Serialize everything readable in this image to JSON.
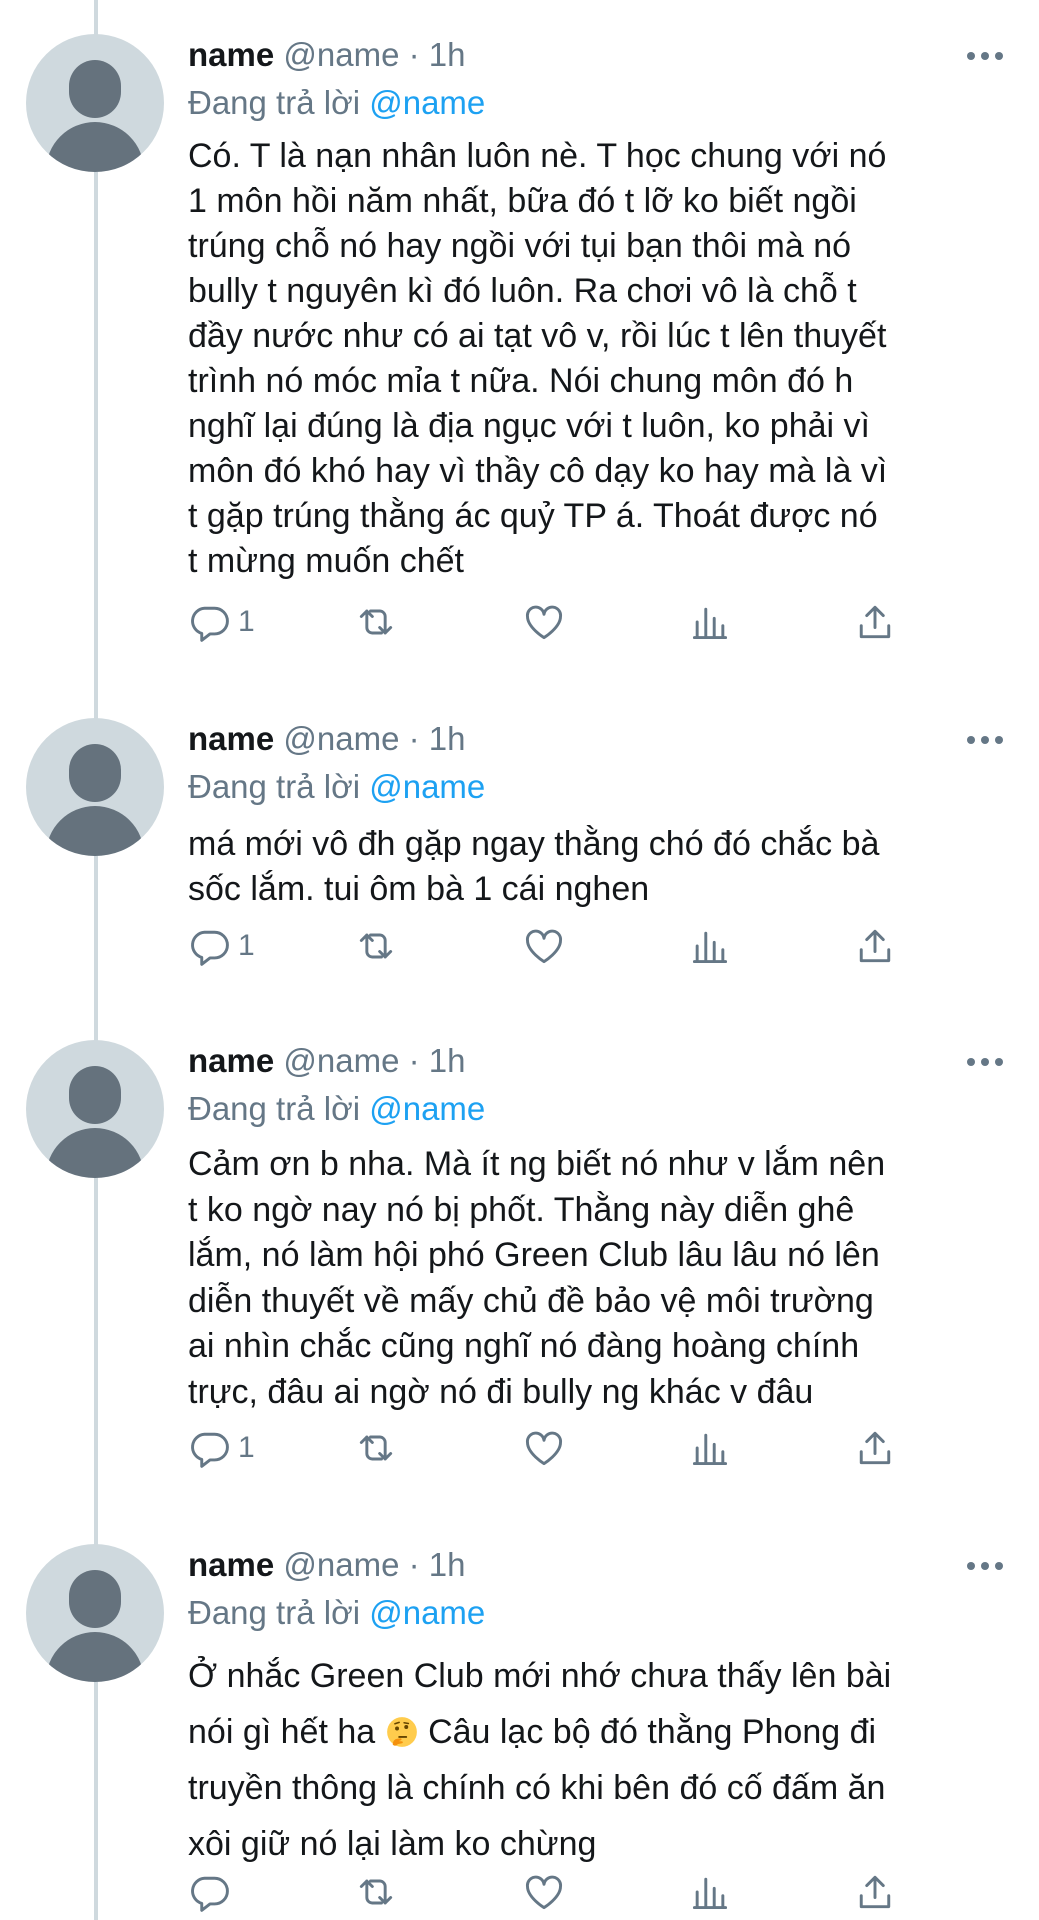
{
  "tweets": [
    {
      "display_name": "name",
      "handle": "@name",
      "separator": "·",
      "time": "1h",
      "replying_prefix": "Đang trả lời",
      "replying_to": "@name",
      "lines": [
        "Có. T là nạn nhân luôn nè. T học chung với nó",
        "1 môn hồi năm nhất, bữa đó t lỡ ko biết ngồi",
        "trúng chỗ nó hay ngồi với tụi bạn thôi mà nó",
        "bully t nguyên kì đó luôn. Ra chơi vô là chỗ t",
        "đầy nước như có ai tạt vô v, rồi lúc t lên thuyết",
        "trình nó móc mỉa t nữa. Nói chung môn đó h",
        "nghĩ lại đúng là địa ngục với t luôn, ko phải vì",
        "môn đó khó hay vì thầy cô dạy ko hay mà là vì",
        "t gặp trúng thằng ác quỷ TP á. Thoát được nó",
        "t mừng muốn chết"
      ],
      "reply_count": "1"
    },
    {
      "display_name": "name",
      "handle": "@name",
      "separator": "·",
      "time": "1h",
      "replying_prefix": "Đang trả lời",
      "replying_to": "@name",
      "lines": [
        "má mới vô đh gặp ngay thằng chó đó chắc bà",
        "sốc lắm. tui ôm bà 1 cái nghen"
      ],
      "reply_count": "1"
    },
    {
      "display_name": "name",
      "handle": "@name",
      "separator": "·",
      "time": "1h",
      "replying_prefix": "Đang trả lời",
      "replying_to": "@name",
      "lines": [
        "Cảm ơn b nha. Mà ít ng biết nó như v lắm nên",
        "t ko ngờ nay nó bị phốt. Thằng này diễn ghê",
        "lắm, nó làm hội phó Green Club lâu lâu nó lên",
        "diễn thuyết về mấy chủ đề bảo vệ môi trường",
        "ai nhìn chắc cũng nghĩ nó đàng hoàng chính",
        "trực, đâu ai ngờ nó đi bully ng khác v đâu"
      ],
      "reply_count": "1"
    },
    {
      "display_name": "name",
      "handle": "@name",
      "separator": "·",
      "time": "1h",
      "replying_prefix": "Đang trả lời",
      "replying_to": "@name",
      "lines": [
        "Ở nhắc Green Club mới nhớ chưa thấy lên bài",
        "nói gì hết ha",
        "truyền thông là chính có khi bên đó cố đấm ăn",
        "xôi giữ nó lại làm ko chừng"
      ],
      "line2_after_emoji": "Câu lạc bộ đó thằng Phong đi",
      "emoji": "thinking-face-emoji",
      "reply_count": ""
    }
  ],
  "icons": {
    "reply": "reply-icon",
    "retweet": "retweet-icon",
    "like": "like-icon",
    "analytics": "analytics-icon",
    "share": "share-icon",
    "more": "more-icon"
  },
  "colors": {
    "link": "#1da1f2",
    "secondary": "#657786",
    "avatar_bg": "#cfd9de",
    "avatar_fg": "#65727d"
  }
}
